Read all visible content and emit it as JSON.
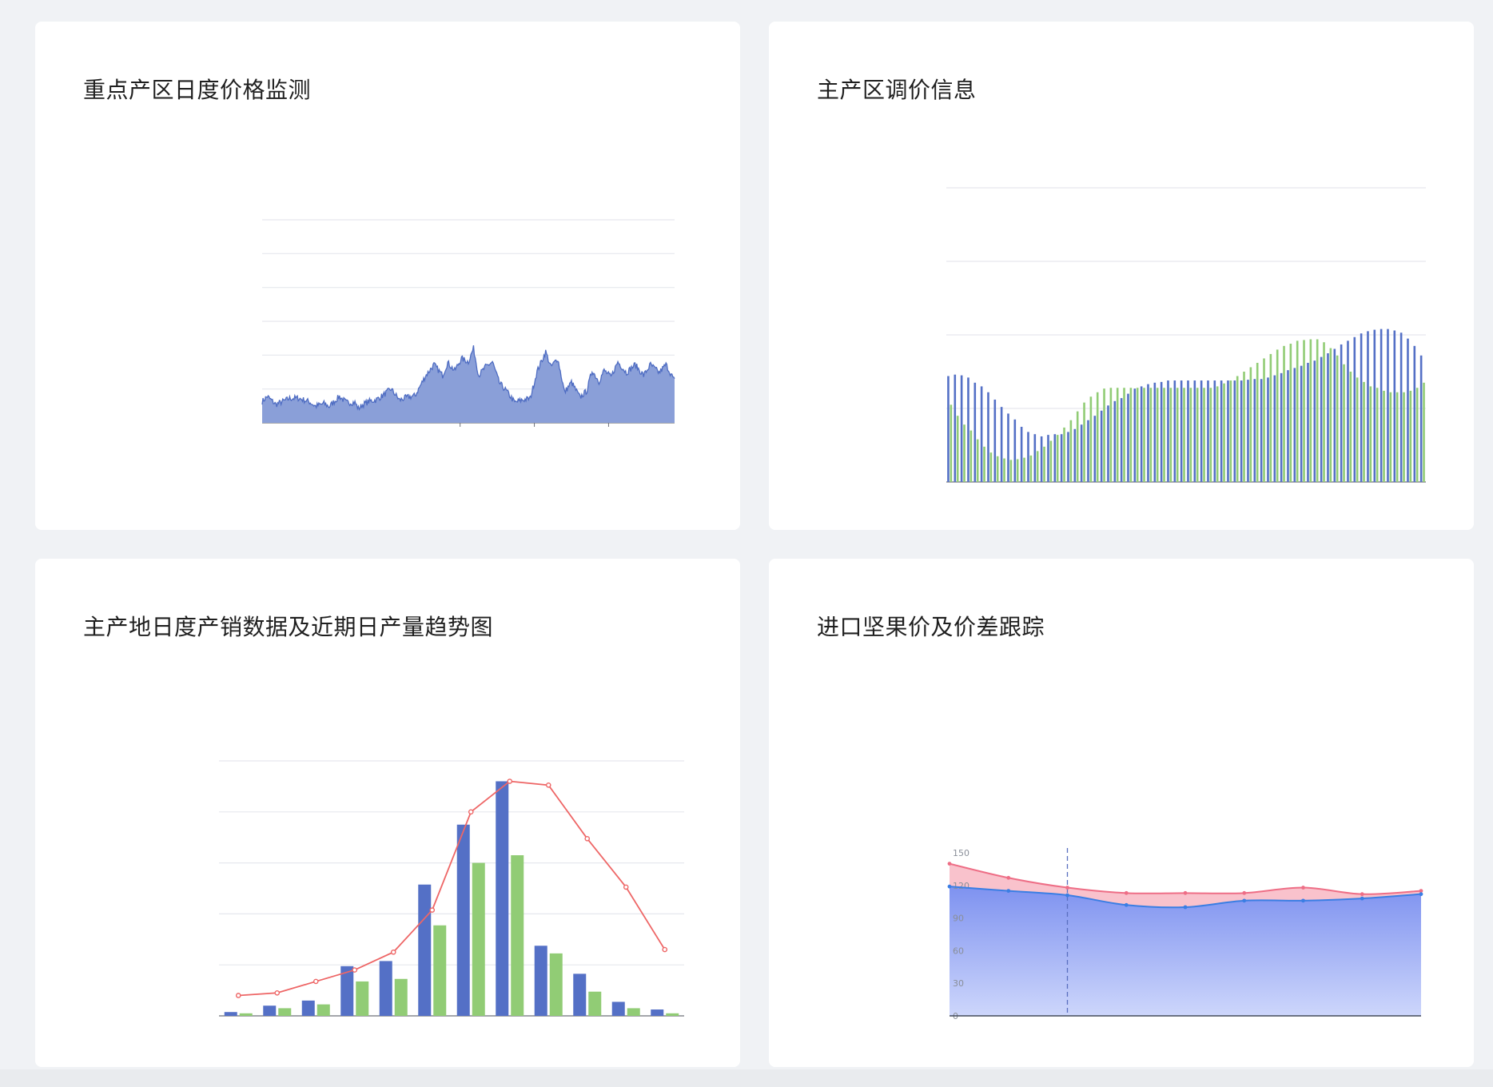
{
  "chart_data": [
    {
      "id": "area-price",
      "type": "area",
      "title": "重点产区日度价格监测",
      "xlabel": "",
      "ylabel": "",
      "n": 480,
      "anchors": [
        [
          0,
          0.63
        ],
        [
          6,
          0.78
        ],
        [
          16,
          0.54
        ],
        [
          32,
          0.72
        ],
        [
          42,
          0.73
        ],
        [
          55,
          0.62
        ],
        [
          62,
          0.49
        ],
        [
          72,
          0.57
        ],
        [
          78,
          0.48
        ],
        [
          90,
          0.78
        ],
        [
          98,
          0.6
        ],
        [
          108,
          0.6
        ],
        [
          112,
          0.42
        ],
        [
          118,
          0.55
        ],
        [
          124,
          0.63
        ],
        [
          132,
          0.67
        ],
        [
          140,
          0.8
        ],
        [
          150,
          1.0
        ],
        [
          160,
          0.67
        ],
        [
          168,
          0.75
        ],
        [
          178,
          0.8
        ],
        [
          190,
          1.38
        ],
        [
          200,
          1.72
        ],
        [
          210,
          1.4
        ],
        [
          216,
          1.78
        ],
        [
          224,
          1.54
        ],
        [
          232,
          1.9
        ],
        [
          240,
          1.8
        ],
        [
          246,
          2.2
        ],
        [
          252,
          1.4
        ],
        [
          260,
          1.65
        ],
        [
          268,
          1.8
        ],
        [
          276,
          1.18
        ],
        [
          284,
          0.95
        ],
        [
          294,
          0.6
        ],
        [
          302,
          0.67
        ],
        [
          312,
          0.72
        ],
        [
          320,
          1.52
        ],
        [
          330,
          2.1
        ],
        [
          336,
          1.65
        ],
        [
          344,
          1.9
        ],
        [
          352,
          0.9
        ],
        [
          360,
          1.2
        ],
        [
          370,
          0.75
        ],
        [
          378,
          0.95
        ],
        [
          384,
          1.55
        ],
        [
          392,
          1.22
        ],
        [
          398,
          1.55
        ],
        [
          406,
          1.35
        ],
        [
          414,
          1.8
        ],
        [
          424,
          1.48
        ],
        [
          434,
          1.72
        ],
        [
          444,
          1.4
        ],
        [
          452,
          1.72
        ],
        [
          462,
          1.48
        ],
        [
          470,
          1.72
        ],
        [
          480,
          1.24
        ]
      ],
      "noise": 0.09,
      "ylim": [
        0,
        6
      ],
      "yticks": [
        0,
        1,
        2,
        3,
        4,
        5,
        6
      ],
      "grid": true,
      "color": "#4e6cc2",
      "fill": "#8a9fd8"
    },
    {
      "id": "bar-adjust",
      "type": "bar",
      "title": "主产区调价信息",
      "xlabel": "",
      "ylabel": "",
      "categories_count": 72,
      "series": [
        {
          "values": [
            1.44,
            1.46,
            1.45,
            1.42,
            1.35,
            1.3,
            1.22,
            1.12,
            1.02,
            0.93,
            0.85,
            0.75,
            0.68,
            0.65,
            0.62,
            0.64,
            0.65,
            0.65,
            0.68,
            0.72,
            0.78,
            0.84,
            0.9,
            0.97,
            1.04,
            1.1,
            1.14,
            1.2,
            1.27,
            1.3,
            1.33,
            1.35,
            1.36,
            1.38,
            1.38,
            1.38,
            1.38,
            1.38,
            1.38,
            1.38,
            1.38,
            1.38,
            1.38,
            1.38,
            1.38,
            1.39,
            1.4,
            1.4,
            1.42,
            1.45,
            1.48,
            1.52,
            1.55,
            1.58,
            1.62,
            1.65,
            1.7,
            1.75,
            1.81,
            1.87,
            1.92,
            1.97,
            2.02,
            2.05,
            2.07,
            2.08,
            2.08,
            2.06,
            2.03,
            1.95,
            1.85,
            1.72
          ],
          "color": "#5470c6"
        },
        {
          "values": [
            1.05,
            0.9,
            0.78,
            0.7,
            0.58,
            0.48,
            0.4,
            0.35,
            0.32,
            0.3,
            0.31,
            0.33,
            0.36,
            0.42,
            0.48,
            0.56,
            0.64,
            0.74,
            0.84,
            0.96,
            1.08,
            1.16,
            1.22,
            1.27,
            1.28,
            1.28,
            1.28,
            1.28,
            1.28,
            1.28,
            1.28,
            1.28,
            1.28,
            1.28,
            1.28,
            1.28,
            1.28,
            1.28,
            1.28,
            1.28,
            1.3,
            1.34,
            1.38,
            1.44,
            1.5,
            1.56,
            1.62,
            1.68,
            1.74,
            1.8,
            1.85,
            1.88,
            1.92,
            1.93,
            1.94,
            1.94,
            1.9,
            1.82,
            1.72,
            1.6,
            1.5,
            1.42,
            1.36,
            1.3,
            1.28,
            1.24,
            1.22,
            1.22,
            1.22,
            1.24,
            1.28,
            1.35
          ],
          "color": "#91cc75"
        }
      ],
      "ylim": [
        0,
        4
      ],
      "yticks": [
        0,
        1,
        2,
        3,
        4
      ],
      "grid": true
    },
    {
      "id": "combo-prod",
      "type": "bar",
      "title": "主产地日度产销数据及近期日产量趋势图",
      "xlabel": "",
      "ylabel": "",
      "categories_count": 12,
      "series": [
        {
          "kind": "bar",
          "values": [
            0.3,
            0.8,
            1.2,
            3.9,
            4.3,
            10.3,
            15.0,
            18.4,
            5.5,
            3.3,
            1.1,
            0.5
          ],
          "color": "#5470c6"
        },
        {
          "kind": "bar",
          "values": [
            0.2,
            0.6,
            0.9,
            2.7,
            2.9,
            7.1,
            12.0,
            12.6,
            4.9,
            1.9,
            0.6,
            0.2
          ],
          "color": "#91cc75"
        },
        {
          "kind": "line",
          "values": [
            1.6,
            1.8,
            2.7,
            3.6,
            5.0,
            8.3,
            16.0,
            18.4,
            18.1,
            13.9,
            10.1,
            5.2
          ],
          "color": "#ee6666"
        }
      ],
      "ylim": [
        0,
        20
      ],
      "yticks": [
        0,
        4,
        8,
        12,
        16,
        20
      ],
      "grid": true
    },
    {
      "id": "area-nut",
      "type": "area",
      "title": "进口坚果价及价差跟踪",
      "xlabel": "",
      "ylabel": "",
      "x": [
        0,
        1,
        2,
        3,
        4,
        5,
        6,
        7,
        8
      ],
      "series": [
        {
          "values": [
            140,
            127,
            118,
            113,
            113,
            113,
            118,
            112,
            115
          ],
          "color": "#ee6e86",
          "fill": "#f9c2cc"
        },
        {
          "values": [
            119,
            115,
            111,
            102,
            100,
            106,
            106,
            108,
            112
          ],
          "color": "#3a7ee4",
          "fill_top": "#7e92f0",
          "fill_bottom": "#cdd6fb"
        }
      ],
      "ylim": [
        0,
        150
      ],
      "yticks": [
        0,
        30,
        60,
        90,
        120,
        150
      ],
      "ytick_labels": [
        "0",
        "30",
        "60",
        "90",
        "120",
        "150"
      ],
      "marker_x": 2
    }
  ]
}
